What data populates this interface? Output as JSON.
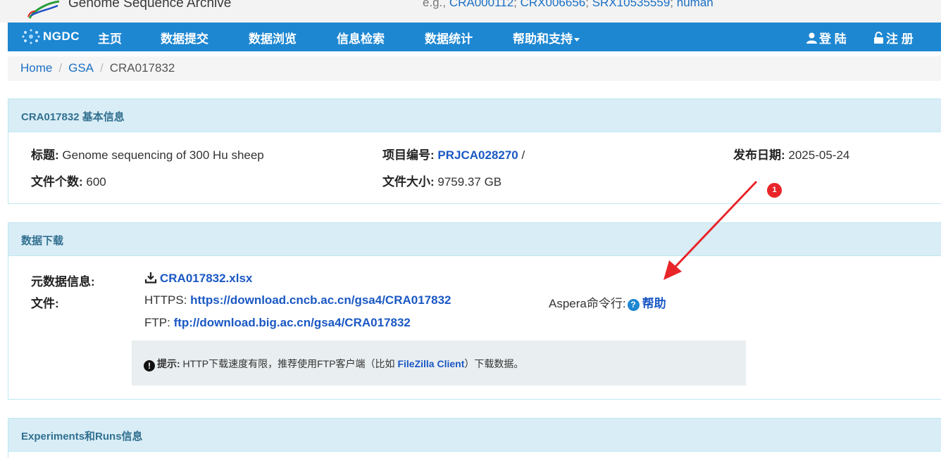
{
  "header": {
    "site_title": "Genome Sequence Archive",
    "search_prefix": "e.g., ",
    "search_examples": [
      "CRA000112",
      "CRX006656",
      "SRX10535559",
      "human"
    ]
  },
  "nav": {
    "brand": "NGDC",
    "items": [
      "主页",
      "数据提交",
      "数据浏览",
      "信息检索",
      "数据统计",
      "帮助和支持"
    ],
    "login": "登 陆",
    "register": "注 册"
  },
  "breadcrumb": {
    "home": "Home",
    "gsa": "GSA",
    "current": "CRA017832"
  },
  "basic_info": {
    "heading": "CRA017832 基本信息",
    "title_label": "标题:",
    "title_value": " Genome sequencing of 300 Hu sheep",
    "project_label": "项目编号:",
    "project_value": "PRJCA028270",
    "project_suffix": " /",
    "release_label": "发布日期:",
    "release_value": " 2025-05-24",
    "file_count_label": "文件个数:",
    "file_count_value": " 600",
    "file_size_label": "文件大小:",
    "file_size_value": " 9759.37 GB"
  },
  "download": {
    "heading": "数据下载",
    "metadata_label": "元数据信息:",
    "metadata_file": "CRA017832.xlsx",
    "file_label": "文件:",
    "https_label": "HTTPS: ",
    "https_link": "https://download.cncb.ac.cn/gsa4/CRA017832",
    "ftp_label": "FTP: ",
    "ftp_link": "ftp://download.big.ac.cn/gsa4/CRA017832",
    "aspera_label": "Aspera命令行:",
    "aspera_help": "帮助",
    "tip_label": "提示:",
    "tip_text_1": " HTTP下载速度有限，推荐使用FTP客户端（比如 ",
    "tip_link": "FileZilla Client",
    "tip_text_2": "）下载数据。"
  },
  "experiments": {
    "heading": "Experiments和Runs信息"
  },
  "annotation": {
    "badge": "1",
    "color": "#e8262a"
  },
  "colors": {
    "nav_bg": "#1e87d2",
    "panel_heading_bg": "#d9edf7",
    "link": "#1a58c4"
  }
}
